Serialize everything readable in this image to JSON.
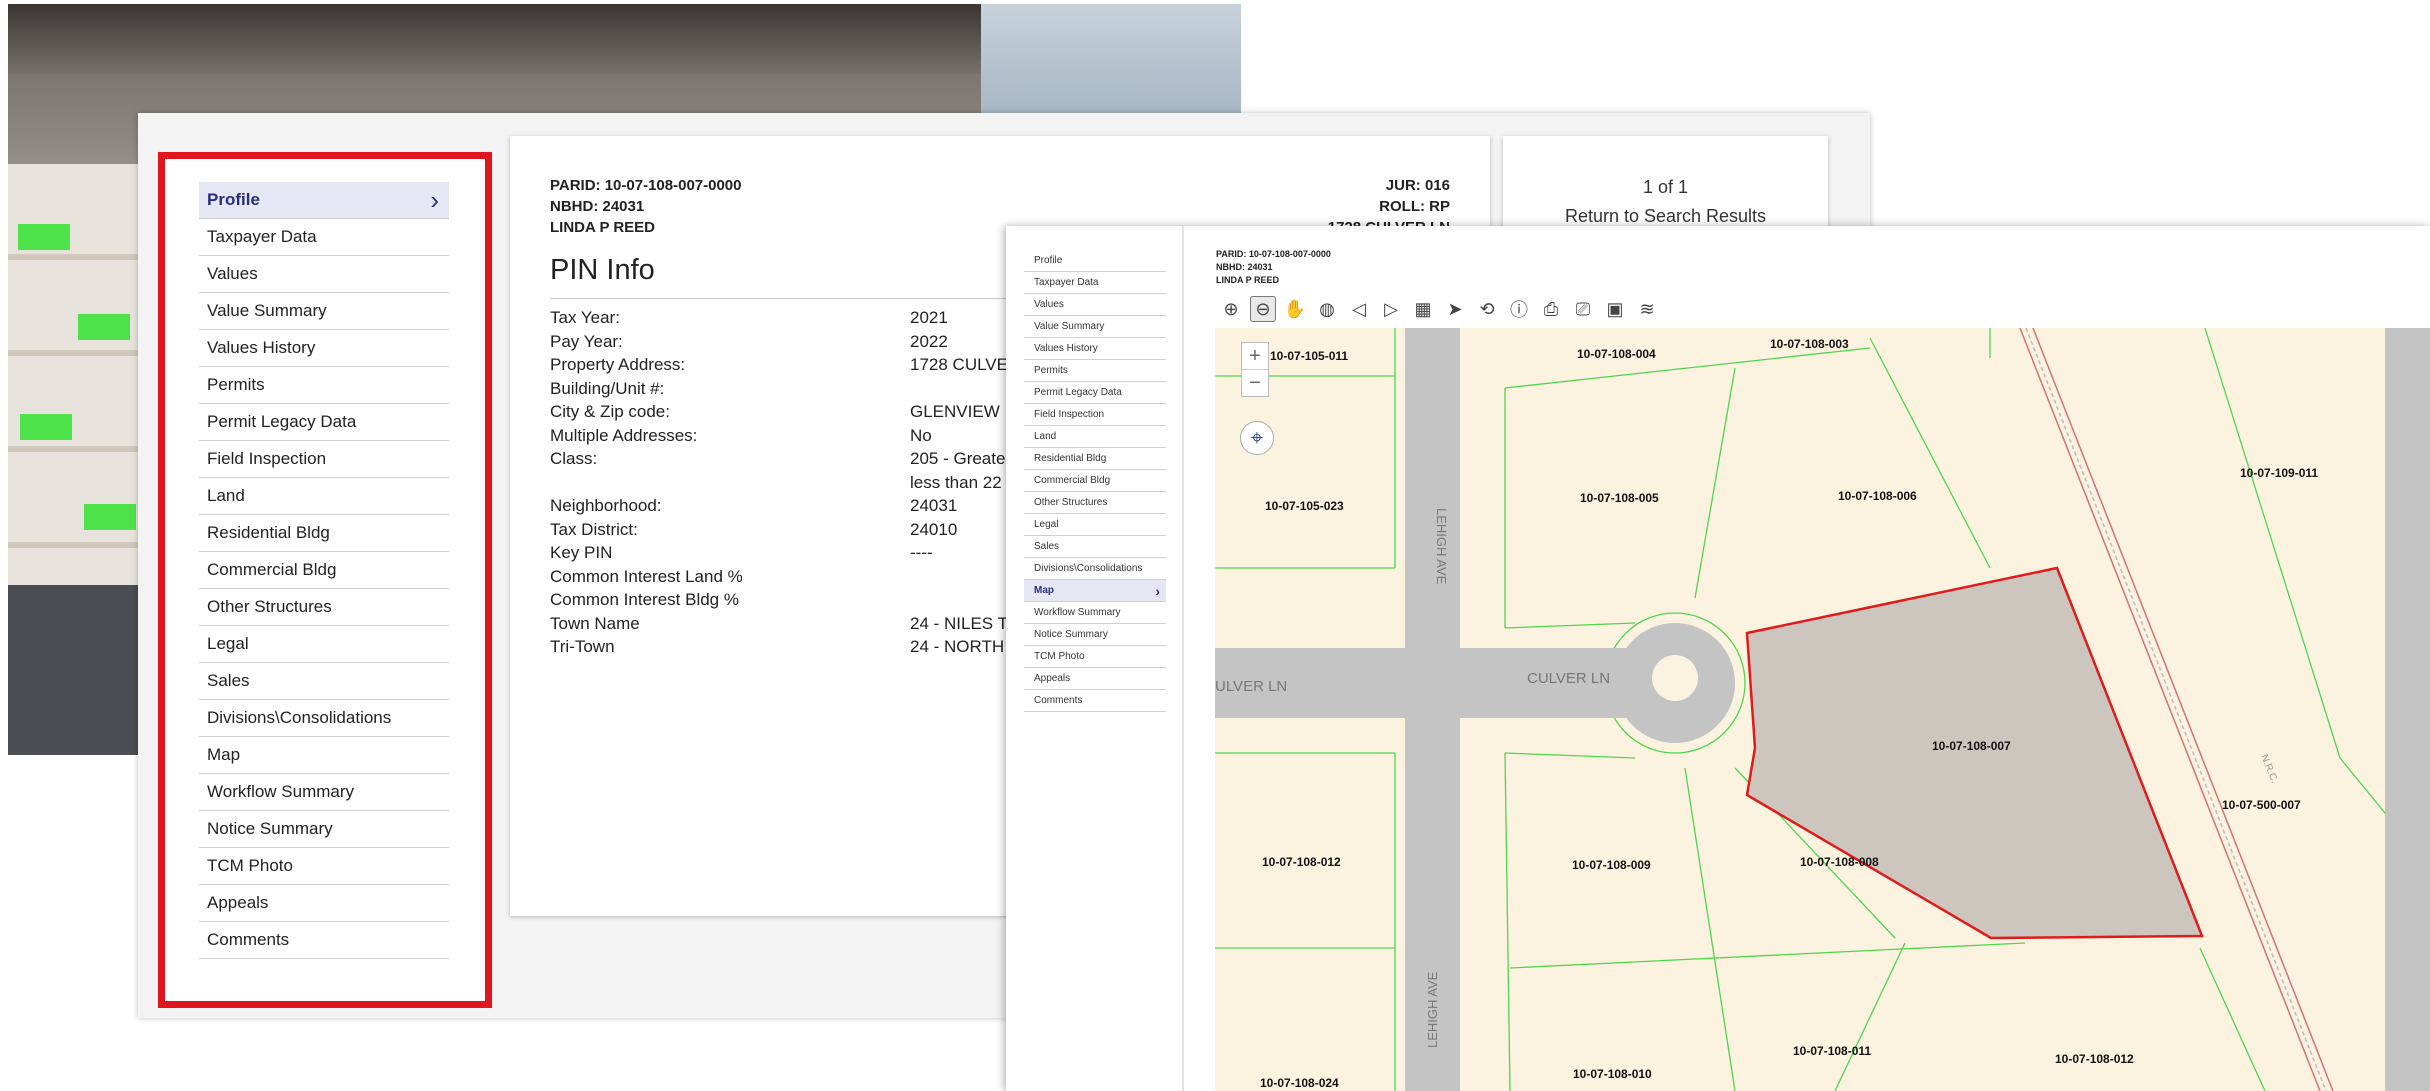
{
  "colors": {
    "highlight_border": "#e0161e",
    "nav_active_bg": "#e6e7f4",
    "nav_active_text": "#2a2d7e",
    "parcel_fill": "#cdc6bf",
    "parcel_outline": "#e01b1b",
    "lot_background": "#fbf2e0",
    "lot_lines": "#4fd64f",
    "road": "#c4c4c4"
  },
  "nav": [
    {
      "label": "Profile",
      "active": true
    },
    {
      "label": "Taxpayer Data"
    },
    {
      "label": "Values"
    },
    {
      "label": "Value Summary"
    },
    {
      "label": "Values History"
    },
    {
      "label": "Permits"
    },
    {
      "label": "Permit Legacy Data"
    },
    {
      "label": "Field Inspection"
    },
    {
      "label": "Land"
    },
    {
      "label": "Residential Bldg"
    },
    {
      "label": "Commercial Bldg"
    },
    {
      "label": "Other Structures"
    },
    {
      "label": "Legal"
    },
    {
      "label": "Sales"
    },
    {
      "label": "Divisions\\Consolidations"
    },
    {
      "label": "Map"
    },
    {
      "label": "Workflow Summary"
    },
    {
      "label": "Notice Summary"
    },
    {
      "label": "TCM Photo"
    },
    {
      "label": "Appeals"
    },
    {
      "label": "Comments"
    }
  ],
  "nav_chevron": "›",
  "header": {
    "parid": "PARID: 10-07-108-007-0000",
    "nbhd": "NBHD: 24031",
    "owner": "LINDA P REED",
    "jur": "JUR: 016",
    "roll": "ROLL: RP",
    "address_partial": "1728 CULVER LN"
  },
  "pin_info": {
    "title": "PIN Info",
    "rows": [
      {
        "k": "Tax Year:",
        "v": "2021"
      },
      {
        "k": "Pay Year:",
        "v": "2022"
      },
      {
        "k": "Property Address:",
        "v": "1728 CULVE"
      },
      {
        "k": "Building/Unit #:",
        "v": ""
      },
      {
        "k": "City & Zip code:",
        "v": "GLENVIEW I"
      },
      {
        "k": "Multiple Addresses:",
        "v": "No"
      },
      {
        "k": "Class:",
        "v": "205 - Greate"
      },
      {
        "k": "",
        "v": "less than 22"
      },
      {
        "k": "Neighborhood:",
        "v": "24031"
      },
      {
        "k": "Tax District:",
        "v": "24010"
      },
      {
        "k": "Key PIN",
        "v": "----"
      },
      {
        "k": "Common Interest Land %",
        "v": ""
      },
      {
        "k": "Common Interest Bldg %",
        "v": ""
      },
      {
        "k": "Town Name",
        "v": "24 - NILES T"
      },
      {
        "k": "Tri-Town",
        "v": "24 - NORTH"
      }
    ]
  },
  "pager": {
    "count": "1 of 1",
    "return_link": "Return to Search Results"
  },
  "map_panel": {
    "nav_active_index": 15,
    "header": {
      "parid": "PARID: 10-07-108-007-0000",
      "nbhd": "NBHD: 24031",
      "owner": "LINDA P REED"
    },
    "toolbar": [
      {
        "icon": "zoom-in-icon",
        "glyph": "⊕"
      },
      {
        "icon": "zoom-out-icon",
        "glyph": "⊖",
        "selected": true
      },
      {
        "icon": "pan-hand-icon",
        "glyph": "✋"
      },
      {
        "icon": "globe-icon",
        "glyph": "◍"
      },
      {
        "icon": "back-arrow-icon",
        "glyph": "◁"
      },
      {
        "icon": "forward-arrow-icon",
        "glyph": "▷"
      },
      {
        "icon": "identify-area-icon",
        "glyph": "▦"
      },
      {
        "icon": "select-arrow-icon",
        "glyph": "➤"
      },
      {
        "icon": "measure-icon",
        "glyph": "⟲"
      },
      {
        "icon": "info-icon",
        "glyph": "ⓘ"
      },
      {
        "icon": "print-layout-icon",
        "glyph": "⎙"
      },
      {
        "icon": "printer-icon",
        "glyph": "⎚"
      },
      {
        "icon": "save-image-icon",
        "glyph": "▣"
      },
      {
        "icon": "layers-icon",
        "glyph": "≋"
      }
    ],
    "zoom_in": "+",
    "zoom_out": "−",
    "locate_glyph": "⌖",
    "streets": {
      "culver_left": "ULVER LN",
      "culver_right": "CULVER LN",
      "lehigh_top": "LEHIGH AVE",
      "lehigh_bottom": "LEHIGH AVE",
      "rail": "N.R.C."
    },
    "parcels": [
      "10-07-105-011",
      "10-07-108-004",
      "10-07-108-003",
      "10-07-105-023",
      "10-07-108-005",
      "10-07-108-006",
      "10-07-109-011",
      "10-07-108-007",
      "10-07-500-007",
      "10-07-108-012",
      "10-07-108-009",
      "10-07-108-008",
      "10-07-108-024",
      "10-07-108-010",
      "10-07-108-011",
      "10-07-108-012"
    ]
  }
}
